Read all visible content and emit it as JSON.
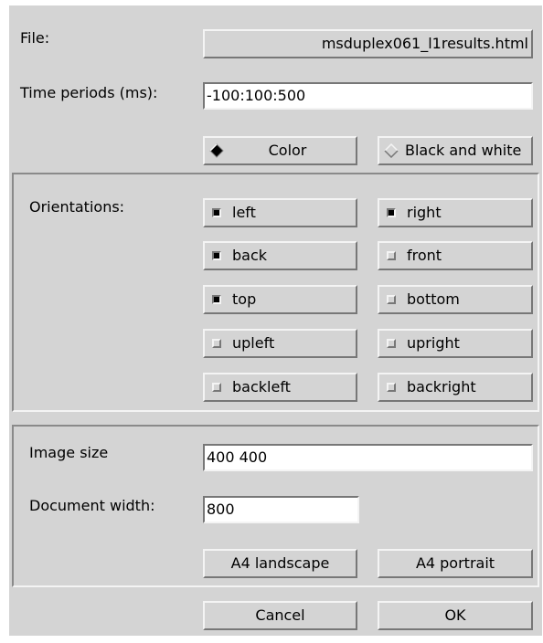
{
  "file": {
    "label": "File:",
    "value": "msduplex061_l1results.html"
  },
  "time": {
    "label": "Time periods (ms):",
    "value": "-100:100:500"
  },
  "color_mode": {
    "color_label": "Color",
    "bw_label": "Black and white",
    "selected": "Color"
  },
  "orientations": {
    "label": "Orientations:",
    "items": [
      {
        "label": "left",
        "checked": true
      },
      {
        "label": "right",
        "checked": true
      },
      {
        "label": "back",
        "checked": true
      },
      {
        "label": "front",
        "checked": false
      },
      {
        "label": "top",
        "checked": true
      },
      {
        "label": "bottom",
        "checked": false
      },
      {
        "label": "upleft",
        "checked": false
      },
      {
        "label": "upright",
        "checked": false
      },
      {
        "label": "backleft",
        "checked": false
      },
      {
        "label": "backright",
        "checked": false
      }
    ]
  },
  "image_size": {
    "label": "Image size",
    "value": "400 400"
  },
  "doc_width": {
    "label": "Document width:",
    "value": "800"
  },
  "presets": {
    "a4_landscape": "A4 landscape",
    "a4_portrait": "A4 portrait"
  },
  "footer": {
    "cancel_label": "Cancel",
    "ok_label": "OK"
  }
}
